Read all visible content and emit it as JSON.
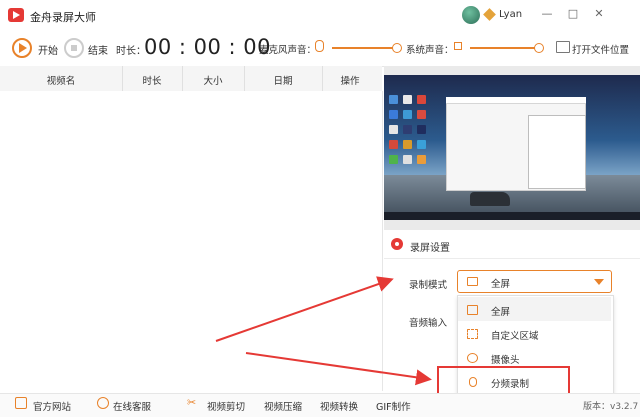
{
  "app": {
    "title": "金舟录屏大师",
    "username": "Lyan"
  },
  "window_controls": [
    "—",
    "□",
    "✕"
  ],
  "toolbar": {
    "start_label": "开始",
    "stop_label": "结束",
    "duration_label": "时长：",
    "timer": "00 : 00 : 00",
    "mic_label": "麦克风声音：",
    "system_sound_label": "系统声音：",
    "open_folder_label": "打开文件位置"
  },
  "table": {
    "columns": [
      "视频名",
      "时长",
      "大小",
      "日期",
      "操作"
    ],
    "rows": []
  },
  "settings": {
    "title": "录屏设置",
    "mode_label": "录制模式",
    "audio_label": "音频输入",
    "mode_selected": "全屏",
    "mode_options": [
      "全屏",
      "自定义区域",
      "摄像头",
      "分频录制"
    ]
  },
  "bottom_bar": {
    "items": [
      {
        "label": "官方网站",
        "icon": "monitor-icon"
      },
      {
        "label": "在线客服",
        "icon": "person-icon"
      },
      {
        "label": "视频剪切",
        "icon": "scissors-icon"
      },
      {
        "label": "视频压缩",
        "icon": ""
      },
      {
        "label": "视频转换",
        "icon": ""
      },
      {
        "label": "GIF制作",
        "icon": ""
      }
    ],
    "version": "版本：v3.2.7"
  },
  "colors": {
    "accent": "#e8822a",
    "brand": "#e53935",
    "annotation": "#e53935"
  }
}
